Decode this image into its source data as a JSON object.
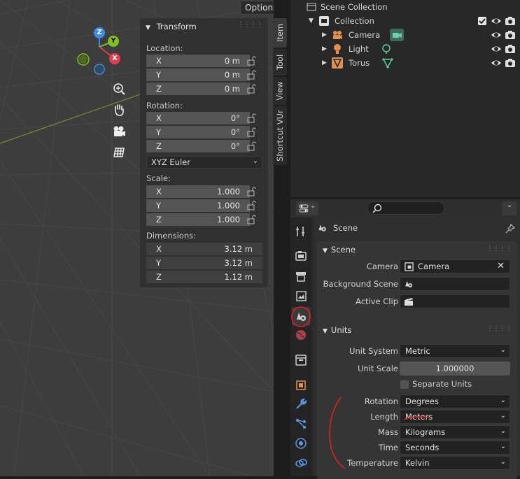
{
  "viewport": {
    "options_label": "Options",
    "gizmo": {
      "z": "Z",
      "y": "Y",
      "x": "X"
    },
    "nav_icons": [
      "zoom-icon",
      "hand-icon",
      "camera-view-icon",
      "ortho-grid-icon"
    ]
  },
  "npanel": {
    "title": "Transform",
    "location_label": "Location:",
    "location": [
      {
        "axis": "X",
        "value": "0 m"
      },
      {
        "axis": "Y",
        "value": "0 m"
      },
      {
        "axis": "Z",
        "value": "0 m"
      }
    ],
    "rotation_label": "Rotation:",
    "rotation": [
      {
        "axis": "X",
        "value": "0°"
      },
      {
        "axis": "Y",
        "value": "0°"
      },
      {
        "axis": "Z",
        "value": "0°"
      }
    ],
    "rotation_mode": "XYZ Euler",
    "scale_label": "Scale:",
    "scale": [
      {
        "axis": "X",
        "value": "1.000"
      },
      {
        "axis": "Y",
        "value": "1.000"
      },
      {
        "axis": "Z",
        "value": "1.000"
      }
    ],
    "dimensions_label": "Dimensions:",
    "dimensions": [
      {
        "axis": "X",
        "value": "3.12 m"
      },
      {
        "axis": "Y",
        "value": "3.12 m"
      },
      {
        "axis": "Z",
        "value": "1.12 m"
      }
    ]
  },
  "sidebar_tabs": [
    "Item",
    "Tool",
    "View",
    "Shortcut VUr"
  ],
  "outliner": {
    "root": "Scene Collection",
    "collection": "Collection",
    "items": [
      "Camera",
      "Light",
      "Torus"
    ]
  },
  "properties": {
    "context_title": "Scene",
    "scene_panel": {
      "title": "Scene",
      "camera_label": "Camera",
      "camera_value": "Camera",
      "background_scene_label": "Background Scene",
      "active_clip_label": "Active Clip"
    },
    "units_panel": {
      "title": "Units",
      "unit_system_label": "Unit System",
      "unit_system": "Metric",
      "unit_scale_label": "Unit Scale",
      "unit_scale": "1.000000",
      "separate_units_label": "Separate Units",
      "rotation_label": "Rotation",
      "rotation": "Degrees",
      "length_label": "Length",
      "length": "Meters",
      "mass_label": "Mass",
      "mass": "Kilograms",
      "time_label": "Time",
      "time": "Seconds",
      "temperature_label": "Temperature",
      "temperature": "Kelvin"
    }
  },
  "colors": {
    "accent_red": "#e02020",
    "gizmo_x": "#e04050",
    "gizmo_y": "#80c020",
    "gizmo_z": "#3a8ee6"
  }
}
